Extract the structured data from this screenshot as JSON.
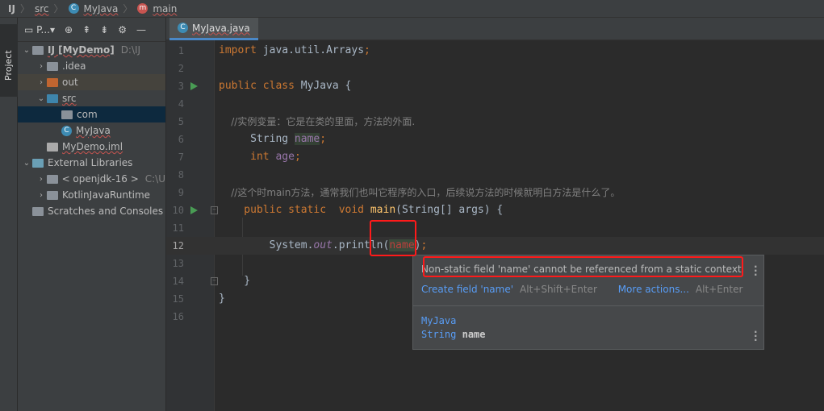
{
  "breadcrumb": {
    "root": "IJ",
    "items": [
      "src",
      "MyJava",
      "main"
    ]
  },
  "sidebar": {
    "project_tab": "Project",
    "view_label": "P..."
  },
  "tree": [
    {
      "label": "IJ [MyDemo]",
      "extra": "D:\\IJ",
      "arrow": "v",
      "indent": 0,
      "color": "#8a9199"
    },
    {
      "label": ".idea",
      "arrow": ">",
      "indent": 1,
      "color": "#8a9199"
    },
    {
      "label": "out",
      "arrow": ">",
      "indent": 1,
      "color": "#c06530"
    },
    {
      "label": "src",
      "arrow": "v",
      "indent": 1,
      "color": "#3e85ac"
    },
    {
      "label": "com",
      "arrow": "",
      "indent": 2,
      "color": "#8a9199"
    },
    {
      "label": "MyJava",
      "arrow": "",
      "indent": 2,
      "color": "class"
    },
    {
      "label": "MyDemo.iml",
      "arrow": "",
      "indent": 1,
      "color": "#aaa"
    },
    {
      "label": "External Libraries",
      "arrow": "v",
      "indent": 0,
      "color": "#6a9fb5"
    },
    {
      "label": "< openjdk-16 >",
      "extra": "C:\\U",
      "arrow": ">",
      "indent": 1,
      "color": "#8a9199"
    },
    {
      "label": "KotlinJavaRuntime",
      "arrow": ">",
      "indent": 1,
      "color": "#8a9199"
    },
    {
      "label": "Scratches and Consoles",
      "arrow": "",
      "indent": 0,
      "color": "#8a9199"
    }
  ],
  "tab": {
    "label": "MyJava.java"
  },
  "code": [
    [
      [
        "kw",
        "import "
      ],
      [
        "pl",
        "java.util.Arrays"
      ],
      [
        "kw",
        ";"
      ]
    ],
    [],
    [
      [
        "kw",
        "public class "
      ],
      [
        "pl",
        "MyJava {"
      ]
    ],
    [],
    [
      [
        "cm",
        "    //实例变量：它是在类的里面，方法的外面."
      ]
    ],
    [
      [
        "pl",
        "     String "
      ],
      [
        "fdh",
        "name"
      ],
      [
        "kw",
        ";"
      ]
    ],
    [
      [
        "kw",
        "     int "
      ],
      [
        "fd",
        "age"
      ],
      [
        "kw",
        ";"
      ]
    ],
    [],
    [
      [
        "cm",
        "    //这个时main方法，通常我们也叫它程序的入口，后续说方法的时候就明白方法是什么了。"
      ]
    ],
    [
      [
        "kw",
        "    public static  void "
      ],
      [
        "fn",
        "main"
      ],
      [
        "pl",
        "(String[] args) {"
      ]
    ],
    [],
    [
      [
        "pl",
        "        System."
      ],
      [
        "it",
        "out"
      ],
      [
        "pl",
        ".println("
      ],
      [
        "err",
        "name"
      ],
      [
        "pl",
        ")"
      ],
      [
        "kw",
        ";"
      ]
    ],
    [],
    [
      [
        "pl",
        "    }"
      ]
    ],
    [
      [
        "pl",
        "}"
      ]
    ],
    []
  ],
  "popup": {
    "message": "Non-static field 'name' cannot be referenced from a static context",
    "action": "Create field 'name'",
    "action_key": "Alt+Shift+Enter",
    "more": "More actions...",
    "more_key": "Alt+Enter",
    "decl_class": "MyJava",
    "decl_type": "String",
    "decl_name": "name"
  }
}
